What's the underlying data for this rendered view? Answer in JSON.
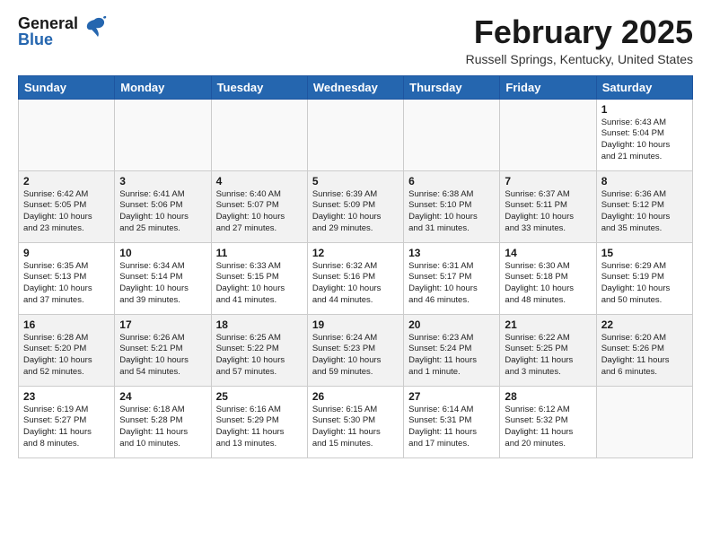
{
  "header": {
    "logo_general": "General",
    "logo_blue": "Blue",
    "month_year": "February 2025",
    "location": "Russell Springs, Kentucky, United States"
  },
  "weekdays": [
    "Sunday",
    "Monday",
    "Tuesday",
    "Wednesday",
    "Thursday",
    "Friday",
    "Saturday"
  ],
  "weeks": [
    [
      {
        "day": "",
        "info": ""
      },
      {
        "day": "",
        "info": ""
      },
      {
        "day": "",
        "info": ""
      },
      {
        "day": "",
        "info": ""
      },
      {
        "day": "",
        "info": ""
      },
      {
        "day": "",
        "info": ""
      },
      {
        "day": "1",
        "info": "Sunrise: 6:43 AM\nSunset: 5:04 PM\nDaylight: 10 hours\nand 21 minutes."
      }
    ],
    [
      {
        "day": "2",
        "info": "Sunrise: 6:42 AM\nSunset: 5:05 PM\nDaylight: 10 hours\nand 23 minutes."
      },
      {
        "day": "3",
        "info": "Sunrise: 6:41 AM\nSunset: 5:06 PM\nDaylight: 10 hours\nand 25 minutes."
      },
      {
        "day": "4",
        "info": "Sunrise: 6:40 AM\nSunset: 5:07 PM\nDaylight: 10 hours\nand 27 minutes."
      },
      {
        "day": "5",
        "info": "Sunrise: 6:39 AM\nSunset: 5:09 PM\nDaylight: 10 hours\nand 29 minutes."
      },
      {
        "day": "6",
        "info": "Sunrise: 6:38 AM\nSunset: 5:10 PM\nDaylight: 10 hours\nand 31 minutes."
      },
      {
        "day": "7",
        "info": "Sunrise: 6:37 AM\nSunset: 5:11 PM\nDaylight: 10 hours\nand 33 minutes."
      },
      {
        "day": "8",
        "info": "Sunrise: 6:36 AM\nSunset: 5:12 PM\nDaylight: 10 hours\nand 35 minutes."
      }
    ],
    [
      {
        "day": "9",
        "info": "Sunrise: 6:35 AM\nSunset: 5:13 PM\nDaylight: 10 hours\nand 37 minutes."
      },
      {
        "day": "10",
        "info": "Sunrise: 6:34 AM\nSunset: 5:14 PM\nDaylight: 10 hours\nand 39 minutes."
      },
      {
        "day": "11",
        "info": "Sunrise: 6:33 AM\nSunset: 5:15 PM\nDaylight: 10 hours\nand 41 minutes."
      },
      {
        "day": "12",
        "info": "Sunrise: 6:32 AM\nSunset: 5:16 PM\nDaylight: 10 hours\nand 44 minutes."
      },
      {
        "day": "13",
        "info": "Sunrise: 6:31 AM\nSunset: 5:17 PM\nDaylight: 10 hours\nand 46 minutes."
      },
      {
        "day": "14",
        "info": "Sunrise: 6:30 AM\nSunset: 5:18 PM\nDaylight: 10 hours\nand 48 minutes."
      },
      {
        "day": "15",
        "info": "Sunrise: 6:29 AM\nSunset: 5:19 PM\nDaylight: 10 hours\nand 50 minutes."
      }
    ],
    [
      {
        "day": "16",
        "info": "Sunrise: 6:28 AM\nSunset: 5:20 PM\nDaylight: 10 hours\nand 52 minutes."
      },
      {
        "day": "17",
        "info": "Sunrise: 6:26 AM\nSunset: 5:21 PM\nDaylight: 10 hours\nand 54 minutes."
      },
      {
        "day": "18",
        "info": "Sunrise: 6:25 AM\nSunset: 5:22 PM\nDaylight: 10 hours\nand 57 minutes."
      },
      {
        "day": "19",
        "info": "Sunrise: 6:24 AM\nSunset: 5:23 PM\nDaylight: 10 hours\nand 59 minutes."
      },
      {
        "day": "20",
        "info": "Sunrise: 6:23 AM\nSunset: 5:24 PM\nDaylight: 11 hours\nand 1 minute."
      },
      {
        "day": "21",
        "info": "Sunrise: 6:22 AM\nSunset: 5:25 PM\nDaylight: 11 hours\nand 3 minutes."
      },
      {
        "day": "22",
        "info": "Sunrise: 6:20 AM\nSunset: 5:26 PM\nDaylight: 11 hours\nand 6 minutes."
      }
    ],
    [
      {
        "day": "23",
        "info": "Sunrise: 6:19 AM\nSunset: 5:27 PM\nDaylight: 11 hours\nand 8 minutes."
      },
      {
        "day": "24",
        "info": "Sunrise: 6:18 AM\nSunset: 5:28 PM\nDaylight: 11 hours\nand 10 minutes."
      },
      {
        "day": "25",
        "info": "Sunrise: 6:16 AM\nSunset: 5:29 PM\nDaylight: 11 hours\nand 13 minutes."
      },
      {
        "day": "26",
        "info": "Sunrise: 6:15 AM\nSunset: 5:30 PM\nDaylight: 11 hours\nand 15 minutes."
      },
      {
        "day": "27",
        "info": "Sunrise: 6:14 AM\nSunset: 5:31 PM\nDaylight: 11 hours\nand 17 minutes."
      },
      {
        "day": "28",
        "info": "Sunrise: 6:12 AM\nSunset: 5:32 PM\nDaylight: 11 hours\nand 20 minutes."
      },
      {
        "day": "",
        "info": ""
      }
    ]
  ]
}
